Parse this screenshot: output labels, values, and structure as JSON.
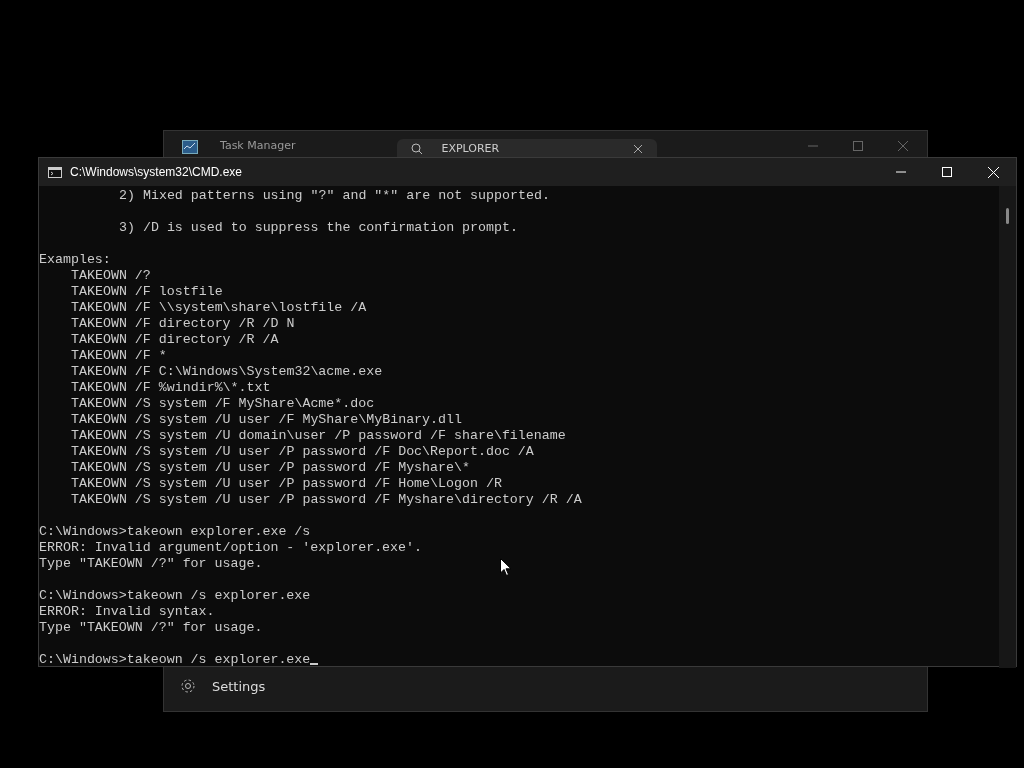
{
  "back_window": {
    "title": "Task Manager",
    "search": {
      "value": "EXPLORER"
    },
    "nav_item": {
      "label": "Settings"
    }
  },
  "cmd_window": {
    "title": "C:\\Windows\\system32\\CMD.exe",
    "lines": [
      {
        "kind": "note",
        "text": "2) Mixed patterns using \"?\" and \"*\" are not supported."
      },
      {
        "kind": "blank"
      },
      {
        "kind": "note",
        "text": "3) /D is used to suppress the confirmation prompt."
      },
      {
        "kind": "blank"
      },
      {
        "kind": "plain",
        "text": "Examples:"
      },
      {
        "kind": "example",
        "text": "TAKEOWN /?"
      },
      {
        "kind": "example",
        "text": "TAKEOWN /F lostfile"
      },
      {
        "kind": "example",
        "text": "TAKEOWN /F \\\\system\\share\\lostfile /A"
      },
      {
        "kind": "example",
        "text": "TAKEOWN /F directory /R /D N"
      },
      {
        "kind": "example",
        "text": "TAKEOWN /F directory /R /A"
      },
      {
        "kind": "example",
        "text": "TAKEOWN /F *"
      },
      {
        "kind": "example",
        "text": "TAKEOWN /F C:\\Windows\\System32\\acme.exe"
      },
      {
        "kind": "example",
        "text": "TAKEOWN /F %windir%\\*.txt"
      },
      {
        "kind": "example",
        "text": "TAKEOWN /S system /F MyShare\\Acme*.doc"
      },
      {
        "kind": "example",
        "text": "TAKEOWN /S system /U user /F MyShare\\MyBinary.dll"
      },
      {
        "kind": "example",
        "text": "TAKEOWN /S system /U domain\\user /P password /F share\\filename"
      },
      {
        "kind": "example",
        "text": "TAKEOWN /S system /U user /P password /F Doc\\Report.doc /A"
      },
      {
        "kind": "example",
        "text": "TAKEOWN /S system /U user /P password /F Myshare\\*"
      },
      {
        "kind": "example",
        "text": "TAKEOWN /S system /U user /P password /F Home\\Logon /R"
      },
      {
        "kind": "example",
        "text": "TAKEOWN /S system /U user /P password /F Myshare\\directory /R /A"
      },
      {
        "kind": "blank"
      },
      {
        "kind": "plain",
        "text": "C:\\Windows>takeown explorer.exe /s"
      },
      {
        "kind": "plain",
        "text": "ERROR: Invalid argument/option - 'explorer.exe'."
      },
      {
        "kind": "plain",
        "text": "Type \"TAKEOWN /?\" for usage."
      },
      {
        "kind": "blank"
      },
      {
        "kind": "plain",
        "text": "C:\\Windows>takeown /s explorer.exe"
      },
      {
        "kind": "plain",
        "text": "ERROR: Invalid syntax."
      },
      {
        "kind": "plain",
        "text": "Type \"TAKEOWN /?\" for usage."
      },
      {
        "kind": "blank"
      },
      {
        "kind": "prompt",
        "text": "C:\\Windows>takeown /s explorer.exe"
      }
    ]
  }
}
